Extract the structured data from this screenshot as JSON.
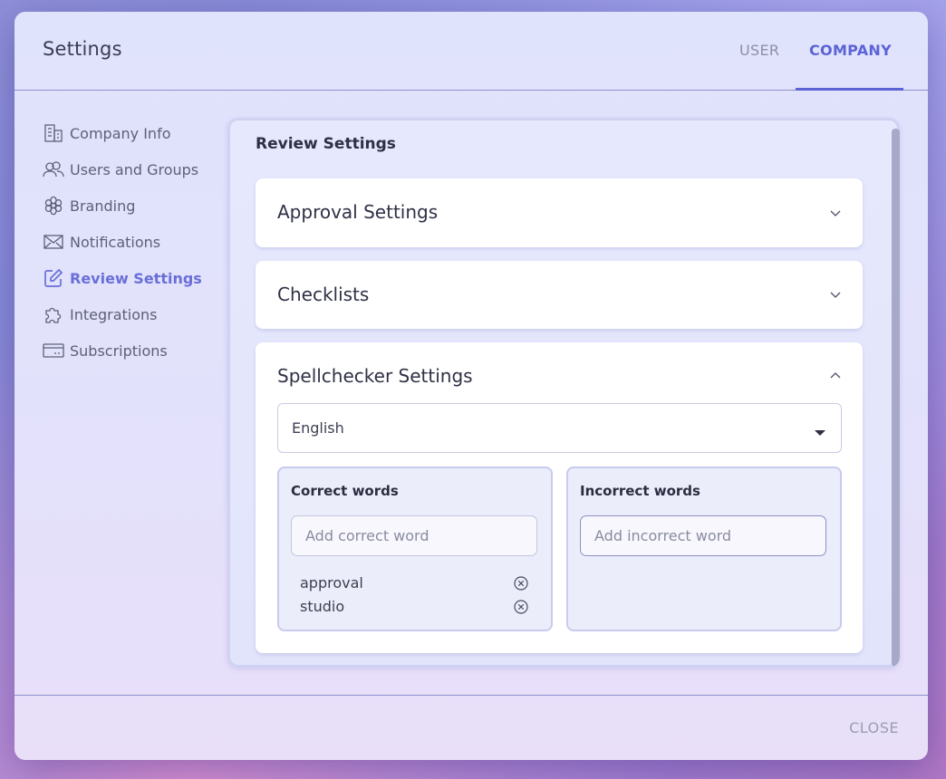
{
  "dialog": {
    "title": "Settings",
    "tabs": [
      {
        "label": "USER",
        "active": false
      },
      {
        "label": "COMPANY",
        "active": true
      }
    ]
  },
  "sidebar": {
    "items": [
      {
        "label": "Company Info",
        "icon": "building-icon",
        "active": false
      },
      {
        "label": "Users and Groups",
        "icon": "users-icon",
        "active": false
      },
      {
        "label": "Branding",
        "icon": "flower-icon",
        "active": false
      },
      {
        "label": "Notifications",
        "icon": "envelope-icon",
        "active": false
      },
      {
        "label": "Review Settings",
        "icon": "edit-icon",
        "active": true
      },
      {
        "label": "Integrations",
        "icon": "puzzle-icon",
        "active": false
      },
      {
        "label": "Subscriptions",
        "icon": "card-icon",
        "active": false
      }
    ]
  },
  "main": {
    "title": "Review Settings",
    "accordions": [
      {
        "title": "Approval Settings",
        "expanded": false
      },
      {
        "title": "Checklists",
        "expanded": false
      },
      {
        "title": "Spellchecker Settings",
        "expanded": true
      }
    ],
    "spellchecker": {
      "language": "English",
      "correct": {
        "title": "Correct words",
        "placeholder": "Add correct word",
        "words": [
          "approval",
          "studio"
        ]
      },
      "incorrect": {
        "title": "Incorrect words",
        "placeholder": "Add incorrect word",
        "words": []
      }
    }
  },
  "footer": {
    "close_label": "CLOSE"
  },
  "colors": {
    "accent": "#5c63d6",
    "active_nav": "#6a6fd8"
  }
}
